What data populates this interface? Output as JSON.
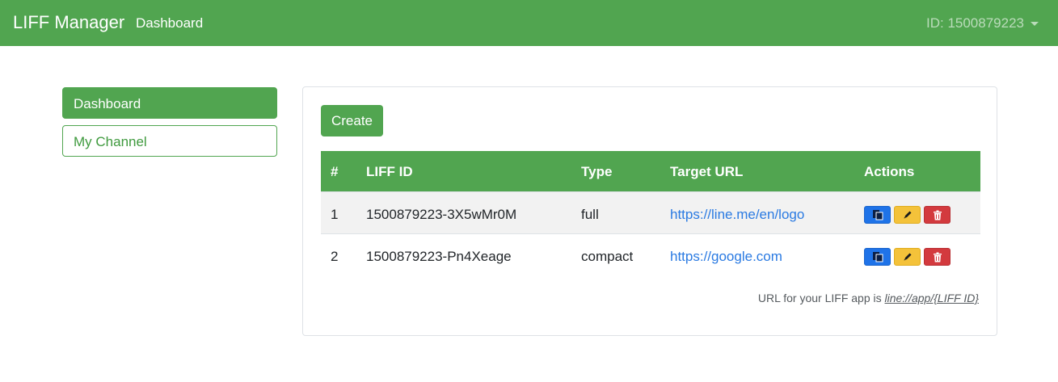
{
  "navbar": {
    "brand": "LIFF Manager",
    "link": "Dashboard",
    "user": "ID: 1500879223"
  },
  "sidebar": {
    "items": [
      {
        "label": "Dashboard",
        "active": true
      },
      {
        "label": "My Channel",
        "active": false
      }
    ]
  },
  "main": {
    "create_label": "Create",
    "table": {
      "headers": [
        "#",
        "LIFF ID",
        "Type",
        "Target URL",
        "Actions"
      ],
      "rows": [
        {
          "num": "1",
          "liff_id": "1500879223-3X5wMr0M",
          "type": "full",
          "url": "https://line.me/en/logo"
        },
        {
          "num": "2",
          "liff_id": "1500879223-Pn4Xeage",
          "type": "compact",
          "url": "https://google.com"
        }
      ],
      "action_icons": [
        "copy-icon",
        "pencil-icon",
        "trash-icon"
      ]
    },
    "footnote_prefix": "URL for your LIFF app is ",
    "footnote_link": "line://app/{LIFF ID}"
  },
  "colors": {
    "primary": "#51a550",
    "link": "#2a7ae2",
    "copy": "#1f73e8",
    "edit": "#f4c23a",
    "delete": "#d33a3e"
  }
}
